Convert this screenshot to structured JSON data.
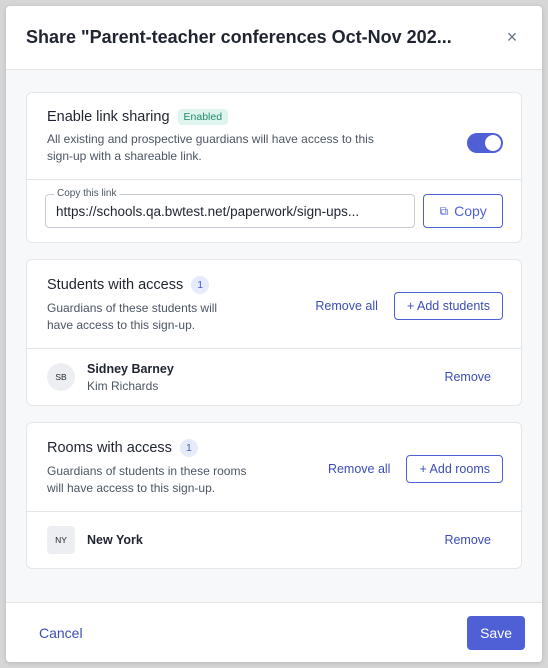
{
  "modal": {
    "title": "Share \"Parent-teacher conferences Oct-Nov 202...",
    "close_icon": "×"
  },
  "link_sharing": {
    "title": "Enable link sharing",
    "badge": "Enabled",
    "description_line1": "All existing and prospective guardians will have access to this",
    "description_line2": "sign-up with a shareable link.",
    "toggle_on": true,
    "copy_label": "Copy this link",
    "link_value": "https://schools.qa.bwtest.net/paperwork/sign-ups...",
    "copy_button": "Copy",
    "copy_icon": "⧉"
  },
  "students": {
    "title": "Students with access",
    "count": "1",
    "description_line1": "Guardians of these students will",
    "description_line2": "have access to this sign-up.",
    "remove_all": "Remove all",
    "add_button": "+ Add students",
    "items": [
      {
        "initials": "SB",
        "name": "Sidney Barney",
        "sub": "Kim Richards",
        "remove": "Remove"
      }
    ]
  },
  "rooms": {
    "title": "Rooms with access",
    "count": "1",
    "description_line1": "Guardians of students in these rooms",
    "description_line2": "will have access to this sign-up.",
    "remove_all": "Remove all",
    "add_button": "+ Add rooms",
    "items": [
      {
        "initials": "NY",
        "name": "New York",
        "remove": "Remove"
      }
    ]
  },
  "footer": {
    "cancel": "Cancel",
    "save": "Save"
  },
  "colors": {
    "accent": "#4f5fd6",
    "enabled_badge_bg": "#dff4ee",
    "enabled_badge_text": "#1f8a6b"
  }
}
